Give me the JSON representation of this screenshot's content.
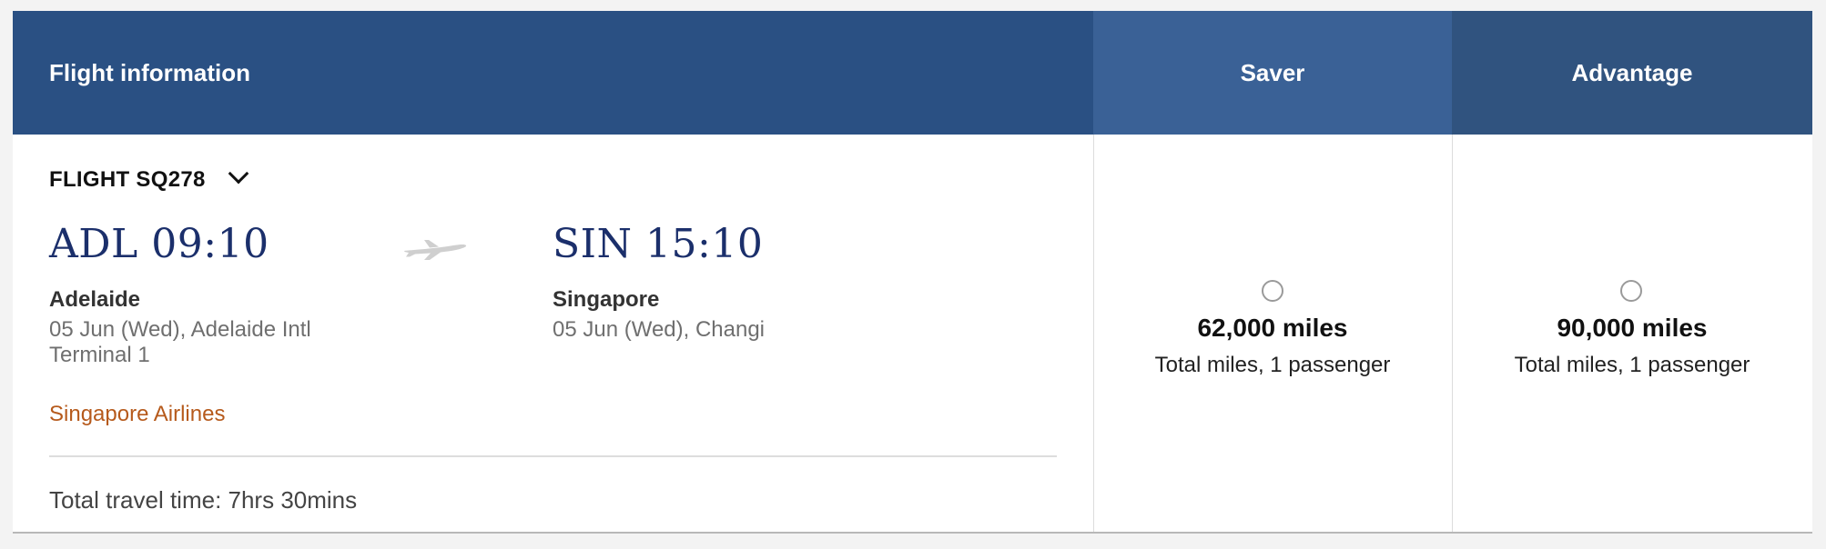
{
  "header": {
    "flight_info_label": "Flight information",
    "saver_label": "Saver",
    "advantage_label": "Advantage"
  },
  "flight": {
    "number": "FLIGHT SQ278",
    "departure": {
      "code_time": "ADL 09:10",
      "city": "Adelaide",
      "details_line1": "05 Jun (Wed), Adelaide Intl",
      "details_line2": "Terminal 1"
    },
    "arrival": {
      "code_time": "SIN 15:10",
      "city": "Singapore",
      "details_line1": "05 Jun (Wed), Changi"
    },
    "airline": "Singapore Airlines",
    "travel_time": "Total travel time: 7hrs 30mins"
  },
  "fares": {
    "saver": {
      "miles": "62,000 miles",
      "subtitle": "Total miles, 1 passenger",
      "selected": false
    },
    "advantage": {
      "miles": "90,000 miles",
      "subtitle": "Total miles, 1 passenger",
      "selected": false
    }
  },
  "icons": {
    "chevron": "chevron-down-icon",
    "plane": "plane-icon"
  },
  "colors": {
    "header_info": "#2a5083",
    "header_saver": "#3a6196",
    "header_advantage": "#30537f",
    "time_text": "#1b2f6b",
    "airline_text": "#b65a1c"
  }
}
